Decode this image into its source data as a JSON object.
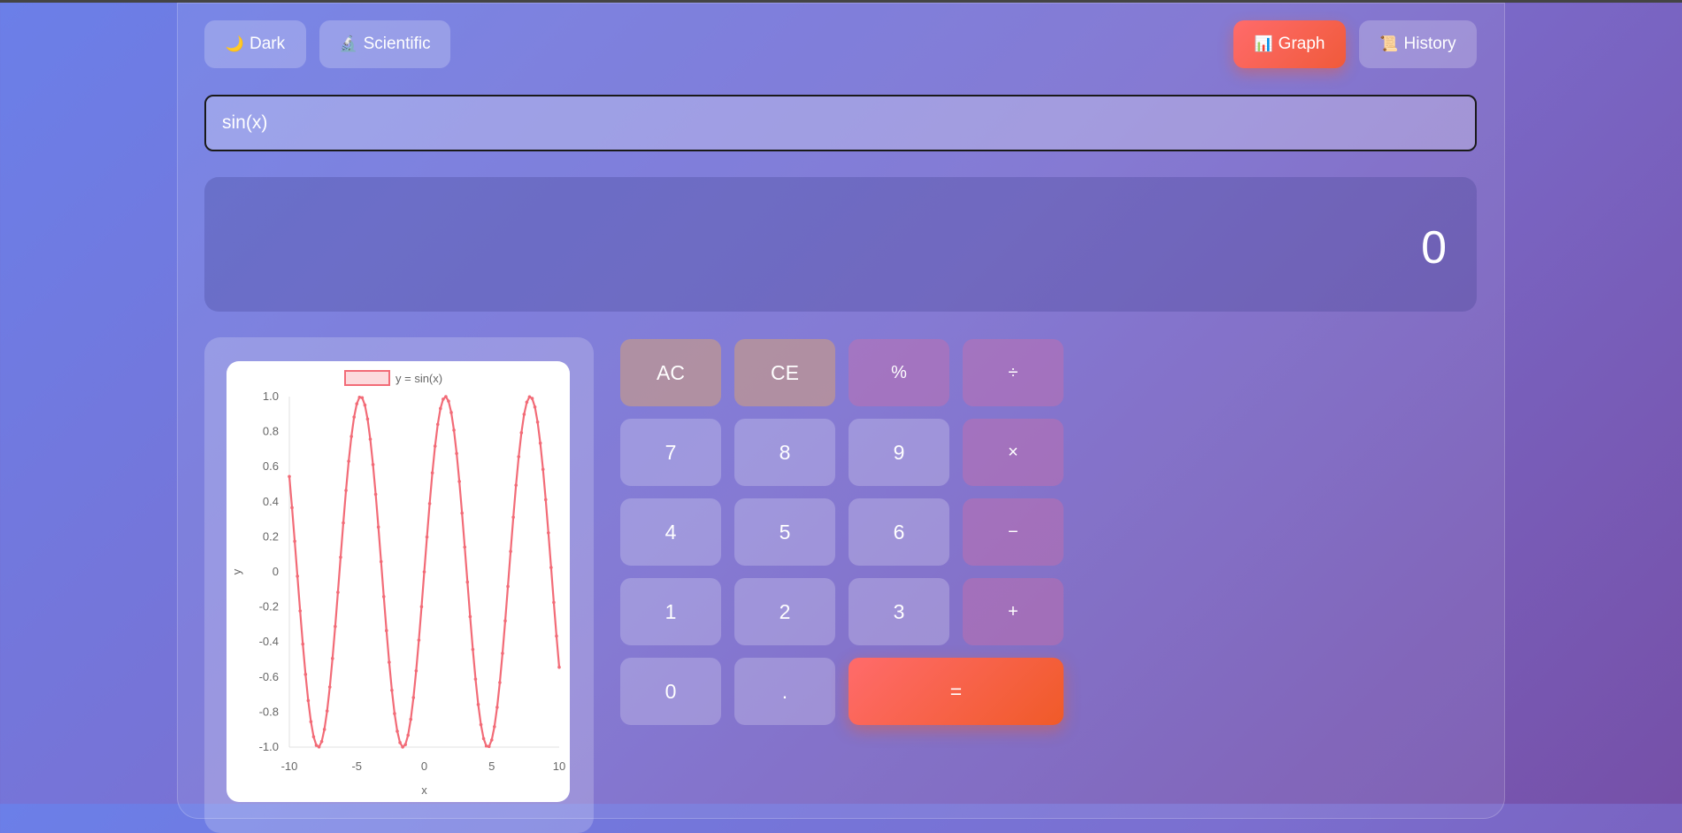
{
  "toolbar": {
    "dark": {
      "icon": "🌙",
      "label": "Dark"
    },
    "scientific": {
      "icon": "🔬",
      "label": "Scientific"
    },
    "graph": {
      "icon": "📊",
      "label": "Graph"
    },
    "history": {
      "icon": "📜",
      "label": "History"
    }
  },
  "expression": {
    "value": "sin(x)"
  },
  "display": {
    "result": "0"
  },
  "keypad": [
    {
      "label": "AC",
      "kind": "clear"
    },
    {
      "label": "CE",
      "kind": "clear"
    },
    {
      "label": "%",
      "kind": "op"
    },
    {
      "label": "÷",
      "kind": "op"
    },
    {
      "label": "7",
      "kind": "num"
    },
    {
      "label": "8",
      "kind": "num"
    },
    {
      "label": "9",
      "kind": "num"
    },
    {
      "label": "×",
      "kind": "op"
    },
    {
      "label": "4",
      "kind": "num"
    },
    {
      "label": "5",
      "kind": "num"
    },
    {
      "label": "6",
      "kind": "num"
    },
    {
      "label": "−",
      "kind": "op"
    },
    {
      "label": "1",
      "kind": "num"
    },
    {
      "label": "2",
      "kind": "num"
    },
    {
      "label": "3",
      "kind": "num"
    },
    {
      "label": "+",
      "kind": "op"
    },
    {
      "label": "0",
      "kind": "num"
    },
    {
      "label": ".",
      "kind": "num"
    },
    {
      "label": "=",
      "kind": "eq"
    }
  ],
  "chart_data": {
    "type": "line",
    "function": "sin(x)",
    "series": [
      {
        "name": "y = sin(x)",
        "color": "#f26b77"
      }
    ],
    "x_range": [
      -10,
      10
    ],
    "x_step": 0.2,
    "xlim": [
      -10,
      10
    ],
    "ylim": [
      -1,
      1
    ],
    "xlabel": "x",
    "ylabel": "y",
    "xticks": [
      "-10",
      "-5",
      "0",
      "5",
      "10"
    ],
    "yticks": [
      "1.0",
      "0.8",
      "0.6",
      "0.4",
      "0.2",
      "0",
      "-0.2",
      "-0.4",
      "-0.6",
      "-0.8",
      "-1.0"
    ],
    "legend": "top-center",
    "grid": false
  }
}
